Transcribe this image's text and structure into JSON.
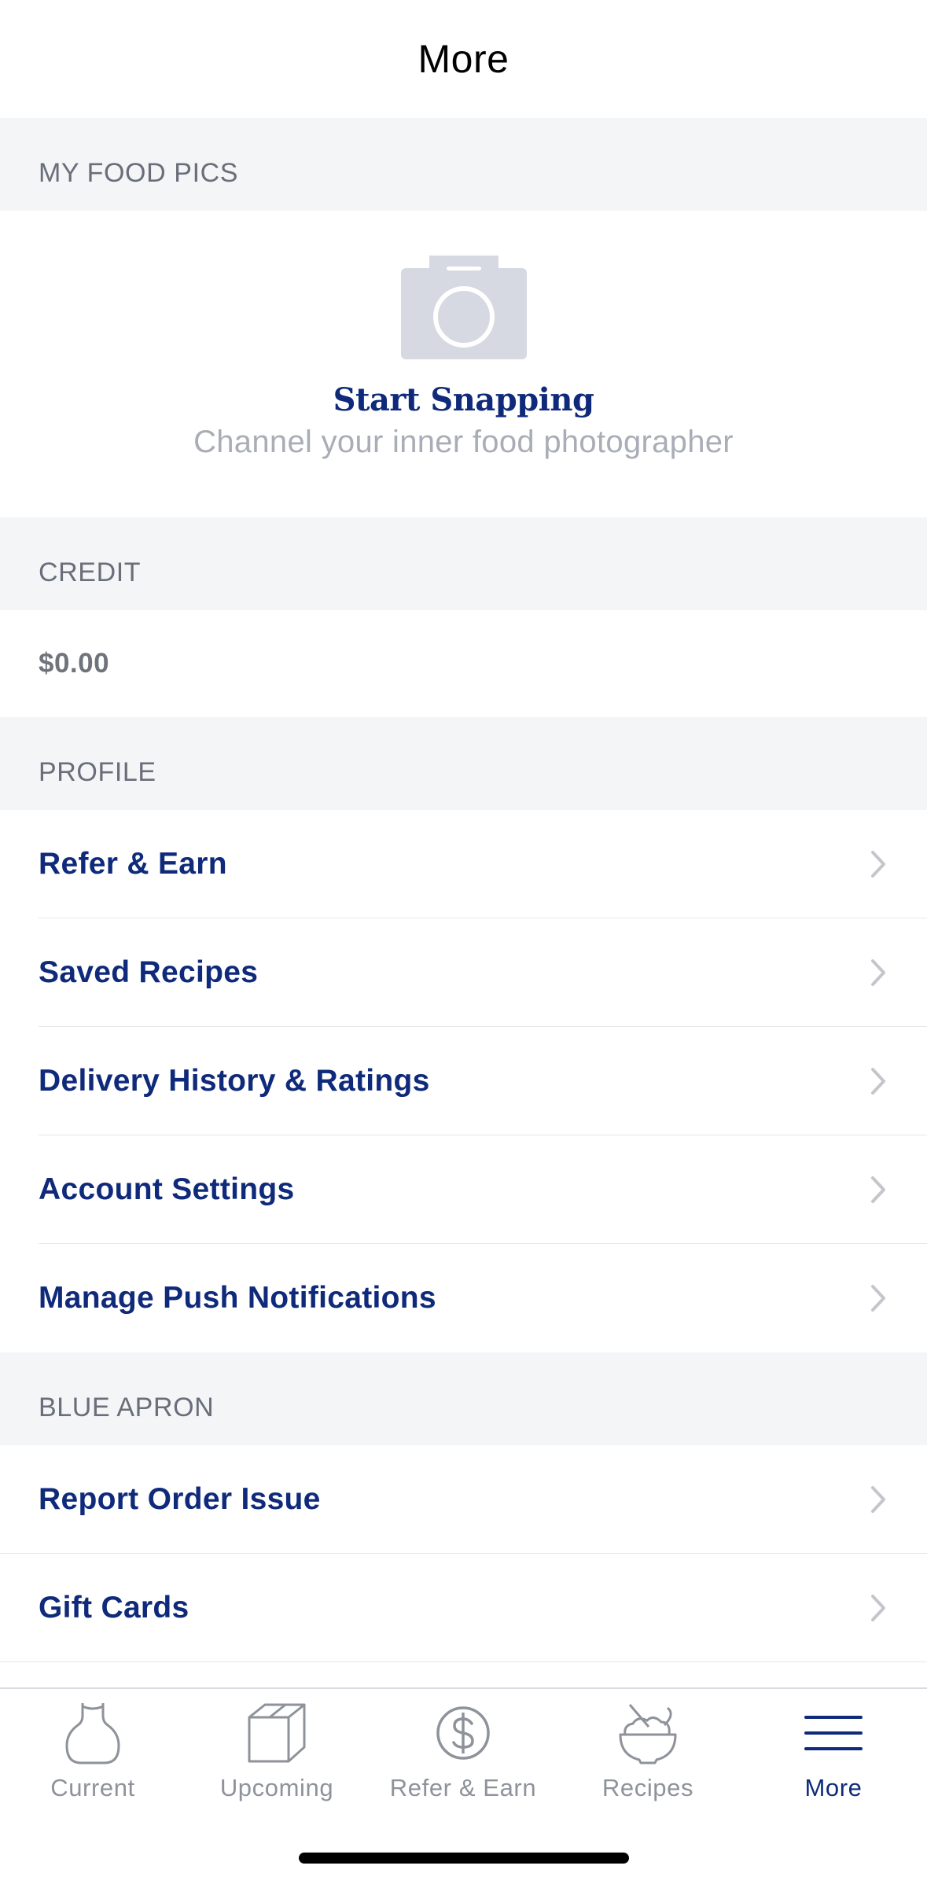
{
  "header": {
    "title": "More"
  },
  "food_pics": {
    "section_label": "MY FOOD PICS",
    "icon": "camera-icon",
    "title": "Start Snapping",
    "subtitle": "Channel your inner food photographer"
  },
  "credit": {
    "section_label": "CREDIT",
    "amount": "$0.00"
  },
  "profile": {
    "section_label": "PROFILE",
    "items": [
      {
        "label": "Refer & Earn"
      },
      {
        "label": "Saved Recipes"
      },
      {
        "label": "Delivery History & Ratings"
      },
      {
        "label": "Account Settings"
      },
      {
        "label": "Manage Push Notifications"
      }
    ]
  },
  "blue_apron": {
    "section_label": "BLUE APRON",
    "items": [
      {
        "label": "Report Order Issue"
      },
      {
        "label": "Gift Cards"
      }
    ]
  },
  "tab_bar": {
    "tabs": [
      {
        "label": "Current",
        "icon": "apron-icon"
      },
      {
        "label": "Upcoming",
        "icon": "box-icon"
      },
      {
        "label": "Refer & Earn",
        "icon": "dollar-coin-icon"
      },
      {
        "label": "Recipes",
        "icon": "bowl-icon"
      },
      {
        "label": "More",
        "icon": "menu-icon",
        "active": true
      }
    ]
  },
  "colors": {
    "brand_blue": "#0f2a7a",
    "section_bg": "#f4f5f7",
    "inactive_tab": "#8e929a",
    "camera_gray": "#d6d9e1"
  }
}
